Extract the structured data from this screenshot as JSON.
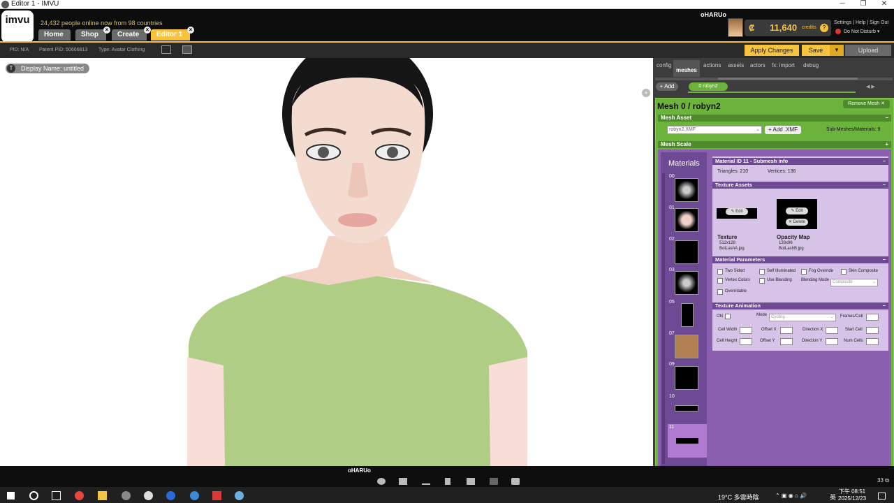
{
  "window": {
    "title": "Editor 1 - IMVU"
  },
  "header": {
    "logo_text": "imvu",
    "online_text": "24,432 people online now from 98 countries",
    "tabs": [
      {
        "label": "Home"
      },
      {
        "label": "Shop"
      },
      {
        "label": "Create"
      },
      {
        "label": "Editor 1"
      }
    ],
    "username": "oHARUo",
    "credits_value": "11,640",
    "credits_label": "credits",
    "credits_symbol": "₡",
    "links": "Settings | Help | Sign Out",
    "status": "Do Not Disturb ▾"
  },
  "infobar": {
    "pid": "PID: N/A",
    "parent_pid": "Parent PID: 50606813",
    "type": "Type: Avatar Clothing",
    "apply_label": "Apply Changes",
    "save_label": "Save",
    "upload_label": "Upload"
  },
  "viewport": {
    "display_name": "Display Name: untitled"
  },
  "panel": {
    "tabs": [
      {
        "label": "config"
      },
      {
        "label": "meshes"
      },
      {
        "label": "actions"
      },
      {
        "label": "assets"
      },
      {
        "label": "actors"
      },
      {
        "label": "fx: import"
      },
      {
        "label": "debug"
      }
    ],
    "add_label": "Add",
    "mesh_tab": "0 robyn2",
    "mesh_title": "Mesh 0 / robyn2",
    "remove_mesh": "Remove Mesh",
    "mesh_asset_label": "Mesh Asset",
    "xmf_value": "robyn2.XMF",
    "add_xmf": "Add .XMF",
    "submeshes": "Sub-Meshes/Materials: 9",
    "mesh_scale_label": "Mesh Scale",
    "materials_title": "Materials",
    "material_numbers": [
      "00",
      "01",
      "02",
      "03",
      "05",
      "07",
      "09",
      "10",
      "11"
    ],
    "material_info_title": "Material ID 11 - Submesh info",
    "triangles": "Triangles: 210",
    "vertices": "Vertices: 136",
    "texture_assets_title": "Texture Assets",
    "edit_label": "Edit",
    "delete_label": "Delete",
    "texture_label": "Texture",
    "texture_size": "512x128",
    "texture_file": "BotLashA.jpg",
    "opacity_label": "Opacity Map",
    "opacity_size": "133x96",
    "opacity_file": "BotLashB.jpg",
    "material_params_title": "Material Parameters",
    "params": {
      "two_sided": "Two Sided",
      "self_illuminated": "Self Illuminated",
      "fog_override": "Fog Override",
      "skin_composite": "Skin Composite",
      "vertex_colors": "Vertex Colors",
      "use_blending": "Use Blending",
      "blending_mode": "Blending Mode",
      "blending_value": "Composite",
      "overridable": "Overridable"
    },
    "texture_anim_title": "Texture Animation",
    "anim": {
      "on": "ON",
      "mode": "Mode",
      "mode_value": "Cycling",
      "frames_cell": "Frames/Cell",
      "cell_width": "Cell Width",
      "offset_x": "Offset X",
      "direction_x": "Direction X",
      "start_cell": "Start Cell",
      "cell_height": "Cell Height",
      "offset_y": "Offset Y",
      "direction_y": "Direction Y",
      "num_cells": "Num Cells"
    }
  },
  "bottom": {
    "name": "oHARUo",
    "count": "33"
  },
  "taskbar": {
    "weather": "19°C 多雲時陰",
    "time": "下午 08:51",
    "date": "2025/12/23",
    "ime": "英"
  },
  "colors": {
    "accent": "#f7c23d",
    "green": "#6cb33b",
    "purple": "#8a5fb0"
  }
}
